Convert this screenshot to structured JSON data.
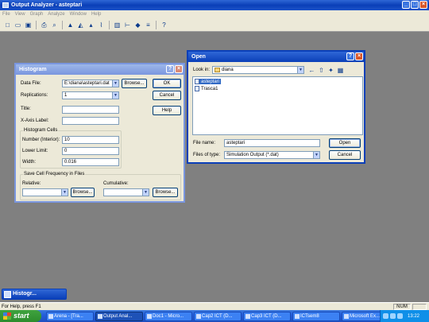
{
  "app": {
    "title": "Output Analyzer - asteptari",
    "menu": [
      "File",
      "View",
      "Graph",
      "Analyze",
      "Window",
      "Help"
    ]
  },
  "histogram": {
    "title": "Histogram",
    "data_file_label": "Data File:",
    "data_file_value": "E:\\diana\\asteptari.dat",
    "browse_label": "Browse...",
    "ok_label": "OK",
    "cancel_label": "Cancel",
    "help_label": "Help",
    "replications_label": "Replications:",
    "replications_value": "1",
    "title_label": "Title:",
    "title_value": "",
    "xaxis_label": "X-Axis Label:",
    "xaxis_value": "",
    "cells_group": "Histogram Cells",
    "number_label": "Number (Interior):",
    "number_value": "10",
    "lower_label": "Lower Limit:",
    "lower_value": "0",
    "width_label": "Width:",
    "width_value": "0.016",
    "save_group": "Save Cell Frequency in Files",
    "relative_label": "Relative:",
    "relative_value": "",
    "cumulative_label": "Cumulative:",
    "cumulative_value": "",
    "browse2_label": "Browse...",
    "browse3_label": "Browse..."
  },
  "open": {
    "title": "Open",
    "lookin_label": "Look in:",
    "lookin_value": "diana",
    "files": [
      "asteptari",
      "Trasca1"
    ],
    "filename_label": "File name:",
    "filename_value": "asteptari",
    "filetype_label": "Files of type:",
    "filetype_value": "Simulation Output (*.dat)",
    "open_label": "Open",
    "cancel_label": "Cancel"
  },
  "minimized": {
    "title": "Histogr..."
  },
  "status": {
    "text": "For Help, press F1",
    "num": "NUM"
  },
  "taskbar": {
    "start": "start",
    "tasks": [
      "Arena - [Tra...",
      "Output Anal...",
      "Doc1 - Micro...",
      "Cap2 ICT (D...",
      "Cap3 ICT (D...",
      "ICTsem8",
      "Microsoft Ex..."
    ],
    "clock": "13:22"
  }
}
